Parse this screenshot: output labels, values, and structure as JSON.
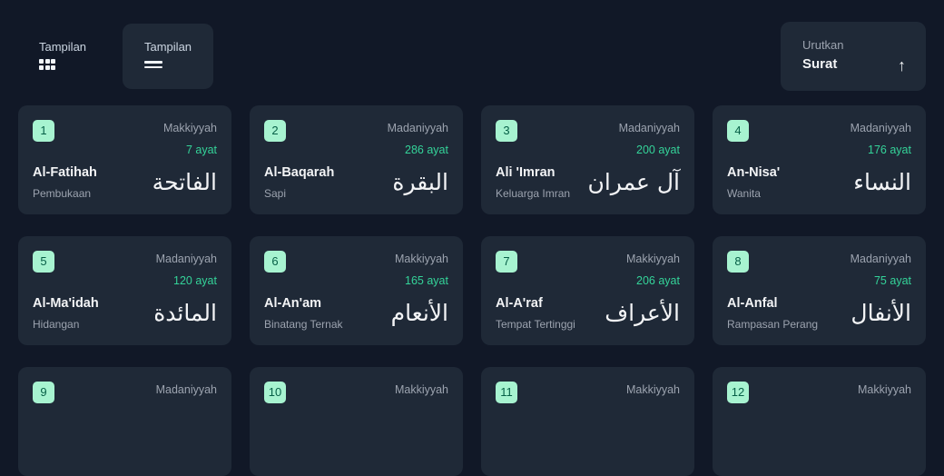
{
  "toolbar": {
    "view_grid_label": "Tampilan",
    "view_list_label": "Tampilan",
    "sort_label": "Urutkan",
    "sort_value": "Surat",
    "sort_icon": "arrow-up-icon"
  },
  "surahs": [
    {
      "number": "1",
      "place": "Makkiyyah",
      "ayat": "7 ayat",
      "name": "Al-Fatihah",
      "meaning": "Pembukaan",
      "arabic": "الفاتحة"
    },
    {
      "number": "2",
      "place": "Madaniyyah",
      "ayat": "286 ayat",
      "name": "Al-Baqarah",
      "meaning": "Sapi",
      "arabic": "البقرة"
    },
    {
      "number": "3",
      "place": "Madaniyyah",
      "ayat": "200 ayat",
      "name": "Ali 'Imran",
      "meaning": "Keluarga Imran",
      "arabic": "آل عمران"
    },
    {
      "number": "4",
      "place": "Madaniyyah",
      "ayat": "176 ayat",
      "name": "An-Nisa'",
      "meaning": "Wanita",
      "arabic": "النساء"
    },
    {
      "number": "5",
      "place": "Madaniyyah",
      "ayat": "120 ayat",
      "name": "Al-Ma'idah",
      "meaning": "Hidangan",
      "arabic": "المائدة"
    },
    {
      "number": "6",
      "place": "Makkiyyah",
      "ayat": "165 ayat",
      "name": "Al-An'am",
      "meaning": "Binatang Ternak",
      "arabic": "الأنعام"
    },
    {
      "number": "7",
      "place": "Makkiyyah",
      "ayat": "206 ayat",
      "name": "Al-A'raf",
      "meaning": "Tempat Tertinggi",
      "arabic": "الأعراف"
    },
    {
      "number": "8",
      "place": "Madaniyyah",
      "ayat": "75 ayat",
      "name": "Al-Anfal",
      "meaning": "Rampasan Perang",
      "arabic": "الأنفال"
    },
    {
      "number": "9",
      "place": "Madaniyyah",
      "ayat": "",
      "name": "",
      "meaning": "",
      "arabic": ""
    },
    {
      "number": "10",
      "place": "Makkiyyah",
      "ayat": "",
      "name": "",
      "meaning": "",
      "arabic": ""
    },
    {
      "number": "11",
      "place": "Makkiyyah",
      "ayat": "",
      "name": "",
      "meaning": "",
      "arabic": ""
    },
    {
      "number": "12",
      "place": "Makkiyyah",
      "ayat": "",
      "name": "",
      "meaning": "",
      "arabic": ""
    }
  ]
}
